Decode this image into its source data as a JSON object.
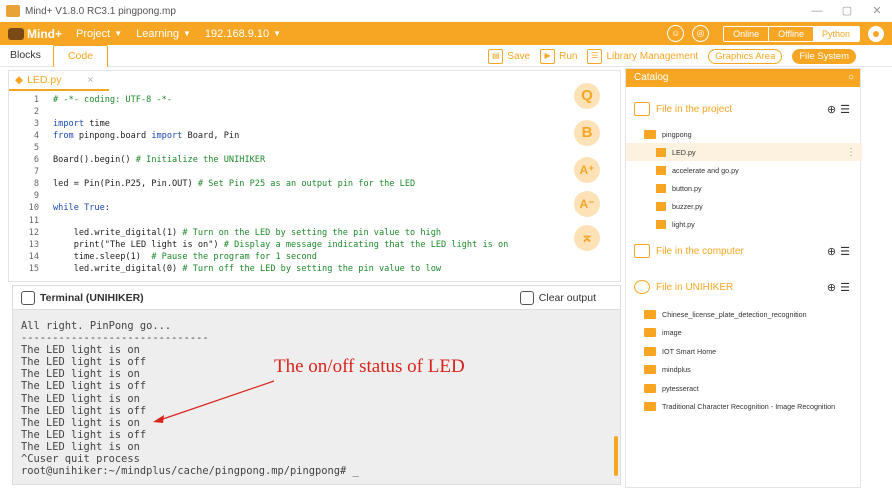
{
  "window": {
    "title": "Mind+ V1.8.0 RC3.1   pingpong.mp",
    "controls": [
      "—",
      "▢",
      "✕"
    ]
  },
  "menubar": {
    "logo": "Mind+",
    "project": "Project",
    "learning": "Learning",
    "ip": "192.168.9.10",
    "modes": [
      "Online",
      "Offline",
      "Python"
    ]
  },
  "toolbar": {
    "tabs": [
      "Blocks",
      "Code"
    ],
    "save": "Save",
    "run": "Run",
    "library": "Library Management",
    "graphics": "Graphics Area",
    "filesystem": "File System"
  },
  "editor": {
    "file_tab": "LED.py",
    "close": "×",
    "lines": [
      {
        "n": "1",
        "t": "# -*- coding: UTF-8 -*-"
      },
      {
        "n": "2",
        "t": ""
      },
      {
        "n": "3",
        "t": "import time"
      },
      {
        "n": "4",
        "t": "from pinpong.board import Board, Pin"
      },
      {
        "n": "5",
        "t": ""
      },
      {
        "n": "6",
        "t": "Board().begin() # Initialize the UNIHIKER"
      },
      {
        "n": "7",
        "t": ""
      },
      {
        "n": "8",
        "t": "led = Pin(Pin.P25, Pin.OUT) # Set Pin P25 as an output pin for the LED"
      },
      {
        "n": "9",
        "t": ""
      },
      {
        "n": "10",
        "t": "while True:"
      },
      {
        "n": "11",
        "t": ""
      },
      {
        "n": "12",
        "t": "    led.write_digital(1) # Turn on the LED by setting the pin value to high"
      },
      {
        "n": "13",
        "t": "    print(\"The LED light is on\") # Display a message indicating that the LED light is on"
      },
      {
        "n": "14",
        "t": "    time.sleep(1)  # Pause the program for 1 second"
      },
      {
        "n": "15",
        "t": "    led.write_digital(0) # Turn off the LED by setting the pin value to low"
      }
    ],
    "side_buttons": [
      "Q",
      "B",
      "A⁺",
      "A⁻",
      "⌅"
    ]
  },
  "terminal": {
    "title": "Terminal (UNIHIKER)",
    "clear": "Clear output",
    "output": "All right. PinPong go...\n------------------------------\nThe LED light is on\nThe LED light is off\nThe LED light is on\nThe LED light is off\nThe LED light is on\nThe LED light is off\nThe LED light is on\nThe LED light is off\nThe LED light is on\n^Cuser quit process\nroot@unihiker:~/mindplus/cache/pingpong.mp/pingpong# _"
  },
  "annotation": "The on/off status of LED",
  "catalog": {
    "title": "Catalog",
    "in_project": "File in the project",
    "project_folder": "pingpong",
    "project_files": [
      "LED.py",
      "accelerate and go.py",
      "button.py",
      "buzzer.py",
      "light.py"
    ],
    "in_computer": "File in the computer",
    "in_unihiker": "File in UNIHIKER",
    "unihiker_folders": [
      "Chinese_license_plate_detection_recognition",
      "image",
      "IOT Smart Home",
      "mindplus",
      "pytesseract",
      "Traditional Character Recognition - Image Recognition"
    ]
  }
}
